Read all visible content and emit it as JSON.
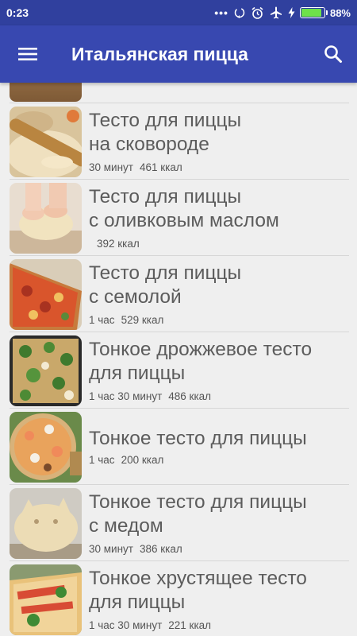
{
  "status_bar": {
    "time": "0:23",
    "battery_percent": "88%",
    "battery_level": 0.88,
    "icons": [
      "dots-icon",
      "sync-icon",
      "alarm-icon",
      "airplane-icon",
      "charging-icon",
      "battery-icon"
    ]
  },
  "app_bar": {
    "title": "Итальянская пицца",
    "menu_icon": "hamburger-menu-icon",
    "search_icon": "search-icon",
    "color": "#3848b0"
  },
  "recipes": [
    {
      "line1": "Тесто для пиццы",
      "line2": "на сковороде",
      "time": "30 минут",
      "kcal": "461 ккал",
      "thumb_icon": "rolling-pin-dough-photo"
    },
    {
      "line1": "Тесто для пиццы",
      "line2": "с оливковым маслом",
      "time": "",
      "kcal": "392 ккал",
      "thumb_icon": "kneading-dough-photo"
    },
    {
      "line1": "Тесто для пиццы",
      "line2": "с семолой",
      "time": "1 час",
      "kcal": "529 ккал",
      "thumb_icon": "pizza-slice-photo"
    },
    {
      "line1": "Тонкое дрожжевое тесто",
      "line2": "для пиццы",
      "time": "1 час 30 минут",
      "kcal": "486 ккал",
      "thumb_icon": "green-pizza-photo"
    },
    {
      "line1": "Тонкое тесто для пиццы",
      "line2": "",
      "time": "1 час",
      "kcal": "200 ккал",
      "thumb_icon": "seafood-pizza-photo"
    },
    {
      "line1": "Тонкое тесто для пиццы",
      "line2": "с медом",
      "time": "30 минут",
      "kcal": "386 ккал",
      "thumb_icon": "dough-ball-photo"
    },
    {
      "line1": "Тонкое хрустящее тесто",
      "line2": "для пиццы",
      "time": "1 час 30 минут",
      "kcal": "221 ккал",
      "thumb_icon": "crispy-pizza-photo"
    }
  ]
}
